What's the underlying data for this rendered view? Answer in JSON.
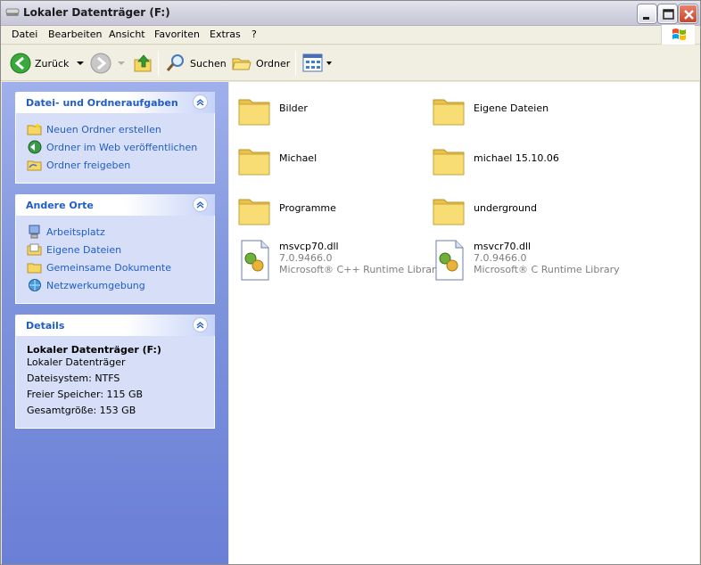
{
  "window": {
    "title": "Lokaler Datenträger (F:)"
  },
  "menu": [
    "Datei",
    "Bearbeiten",
    "Ansicht",
    "Favoriten",
    "Extras",
    "?"
  ],
  "toolbar": {
    "back_label": "Zurück",
    "search_label": "Suchen",
    "folders_label": "Ordner"
  },
  "tasks_panel": {
    "title": "Datei- und Ordneraufgaben",
    "items": [
      "Neuen Ordner erstellen",
      "Ordner im Web veröffentlichen",
      "Ordner freigeben"
    ]
  },
  "places_panel": {
    "title": "Andere Orte",
    "items": [
      "Arbeitsplatz",
      "Eigene Dateien",
      "Gemeinsame Dokumente",
      "Netzwerkumgebung"
    ]
  },
  "details_panel": {
    "title": "Details",
    "name": "Lokaler Datenträger (F:)",
    "type": "Lokaler Datenträger",
    "filesystem": "Dateisystem: NTFS",
    "free": "Freier Speicher: 115 GB",
    "total": "Gesamtgröße: 153 GB"
  },
  "folders": [
    "Bilder",
    "Eigene Dateien",
    "Michael",
    "michael 15.10.06",
    "Programme",
    "underground"
  ],
  "files": [
    {
      "name": "msvcp70.dll",
      "version": "7.0.9466.0",
      "description": "Microsoft® C++ Runtime Library"
    },
    {
      "name": "msvcr70.dll",
      "version": "7.0.9466.0",
      "description": "Microsoft® C Runtime Library"
    }
  ],
  "colors": {
    "link": "#215dc6",
    "pane_bg": "#7f95dd",
    "folder": "#f6d664"
  }
}
